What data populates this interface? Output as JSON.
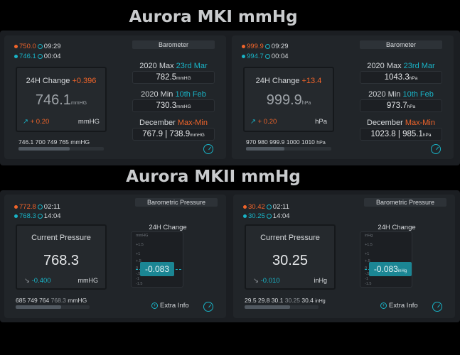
{
  "titles": {
    "mk1": "Aurora MKI mmHg",
    "mk2": "Aurora MKII mmHg"
  },
  "colors": {
    "orange": "#f0642a",
    "teal": "#19b3c6",
    "bg": "#000000",
    "card": "#212529"
  },
  "cards": [
    {
      "max_val": "750.0",
      "max_time": "09:29",
      "min_val": "746.1",
      "min_time": "00:04",
      "header": "Barometer",
      "change_label": "24H Change",
      "change_val": "+0.396",
      "main_val": "746.1",
      "main_unit": "mmHG",
      "trend_val": "+ 0.20",
      "trend_unit": "mmHG",
      "max_label_a": "2020 Max",
      "max_label_b": "23rd Mar",
      "max_value": "782.5",
      "max_unit": "mmHG",
      "min_label_a": "2020 Min",
      "min_label_b": "10th Feb",
      "min_value": "730.3",
      "min_unit": "mmHG",
      "dec_label_a": "December",
      "dec_label_b": "Max-Min",
      "dec_value": "767.9 | 738.9",
      "dec_unit": "mmHG",
      "footer": "746.1 700 749 765 mmHG",
      "progress": 0.6
    },
    {
      "max_val": "999.9",
      "max_time": "09:29",
      "min_val": "994.7",
      "min_time": "00:04",
      "header": "Barometer",
      "change_label": "24H Change",
      "change_val": "+13.4",
      "main_val": "999.9",
      "main_unit": "hPa",
      "trend_val": "+ 0.20",
      "trend_unit": "hPa",
      "max_label_a": "2020 Max",
      "max_label_b": "23rd Mar",
      "max_value": "1043.3",
      "max_unit": "hPa",
      "min_label_a": "2020 Min",
      "min_label_b": "10th Feb",
      "min_value": "973.7",
      "min_unit": "hPa",
      "dec_label_a": "December",
      "dec_label_b": "Max-Min",
      "dec_value": "1023.8 | 985.1",
      "dec_unit": "hPa",
      "footer": "970 980 999.9 1000 1010",
      "footer_unit": "hPa",
      "progress": 0.45
    },
    {
      "max_val": "772.8",
      "max_time": "02:11",
      "min_val": "768.3",
      "min_time": "14:04",
      "header": "Barometric Pressure",
      "main_label": "Current Pressure",
      "main_val": "768.3",
      "trend_val": "-0.400",
      "trend_unit": "mmHG",
      "chart_title": "24H Change",
      "chart_unit": "mmHG",
      "ticks": [
        "+1.5",
        "+1",
        "+.5",
        "0",
        "-.5",
        "-1",
        "-1.5"
      ],
      "pill_val": "-0.083",
      "pill_unit": "",
      "footer_a": "685 749 764 ",
      "footer_b": "768.3",
      "footer_c": " mmHG",
      "extra": "Extra Info",
      "progress": 0.62
    },
    {
      "max_val": "30.42",
      "max_time": "02:11",
      "min_val": "30.25",
      "min_time": "14:04",
      "header": "Barometric Pressure",
      "main_label": "Current Pressure",
      "main_val": "30.25",
      "trend_val": "-0.010",
      "trend_unit": "inHg",
      "chart_title": "24H Change",
      "chart_unit": "inHg",
      "ticks": [
        "+1.5",
        "+1",
        "+.5",
        "0",
        "-.5",
        "-1",
        "-1.5"
      ],
      "pill_val": "-0.083",
      "pill_unit": "inHg",
      "footer_a": "29.5 29.8 30.1 ",
      "footer_b": "30.25",
      "footer_c": " 30.4",
      "footer_unit": "inHg",
      "extra": "Extra Info",
      "progress": 0.62
    }
  ]
}
